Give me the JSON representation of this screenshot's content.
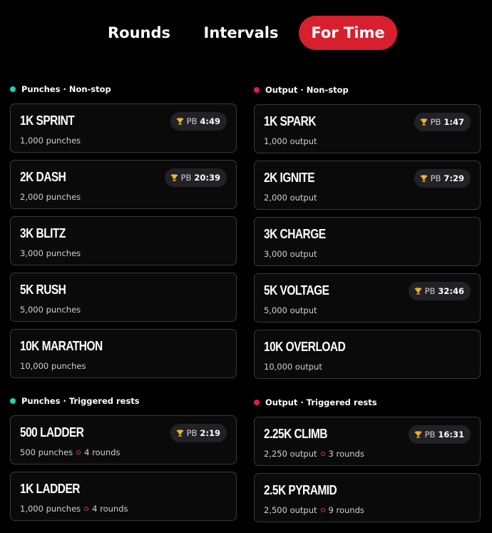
{
  "tabs": [
    {
      "label": "Rounds",
      "active": false
    },
    {
      "label": "Intervals",
      "active": false
    },
    {
      "label": "For Time",
      "active": true
    }
  ],
  "colors": {
    "accent": "#d6202e",
    "punches_dot": "#1fd3b4",
    "output_dot": "#e8174a"
  },
  "sections": {
    "punches_nonstop": {
      "title": "Punches · Non-stop",
      "cards": [
        {
          "name": "1K SPRINT",
          "sub": "1,000 punches",
          "pb_label": "PB",
          "pb": "4:49"
        },
        {
          "name": "2K DASH",
          "sub": "2,000 punches",
          "pb_label": "PB",
          "pb": "20:39"
        },
        {
          "name": "3K BLITZ",
          "sub": "3,000 punches"
        },
        {
          "name": "5K RUSH",
          "sub": "5,000 punches"
        },
        {
          "name": "10K MARATHON",
          "sub": "10,000 punches"
        }
      ]
    },
    "output_nonstop": {
      "title": "Output · Non-stop",
      "cards": [
        {
          "name": "1K SPARK",
          "sub": "1,000 output",
          "pb_label": "PB",
          "pb": "1:47"
        },
        {
          "name": "2K IGNITE",
          "sub": "2,000 output",
          "pb_label": "PB",
          "pb": "7:29"
        },
        {
          "name": "3K CHARGE",
          "sub": "3,000 output"
        },
        {
          "name": "5K VOLTAGE",
          "sub": "5,000 output",
          "pb_label": "PB",
          "pb": "32:46"
        },
        {
          "name": "10K OVERLOAD",
          "sub": "10,000 output"
        }
      ]
    },
    "punches_triggered": {
      "title": "Punches · Triggered rests",
      "cards": [
        {
          "name": "500 LADDER",
          "sub": "500 punches",
          "rounds": "4 rounds",
          "pb_label": "PB",
          "pb": "2:19"
        },
        {
          "name": "1K LADDER",
          "sub": "1,000 punches",
          "rounds": "4 rounds"
        }
      ]
    },
    "output_triggered": {
      "title": "Output · Triggered rests",
      "cards": [
        {
          "name": "2.25K CLIMB",
          "sub": "2,250 output",
          "rounds": "3 rounds",
          "pb_label": "PB",
          "pb": "16:31"
        },
        {
          "name": "2.5K PYRAMID",
          "sub": "2,500 output",
          "rounds": "9 rounds"
        }
      ]
    }
  }
}
